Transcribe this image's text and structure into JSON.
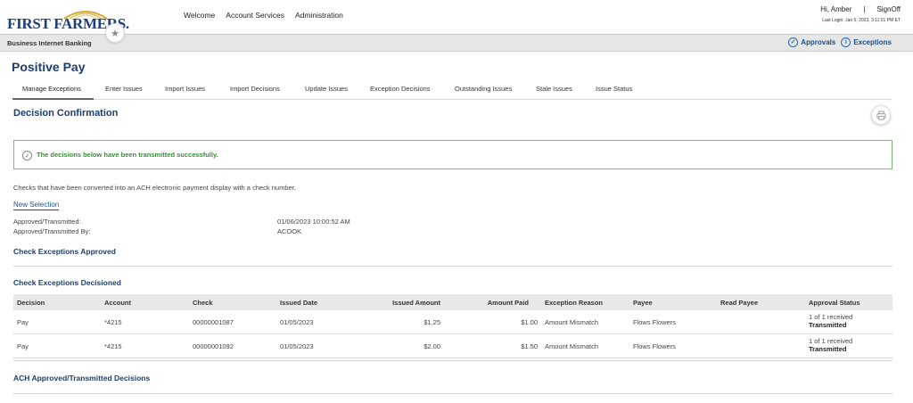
{
  "header": {
    "logo_text": "FIRST FARMERS.",
    "nav": [
      "Welcome",
      "Account Services",
      "Administration"
    ],
    "greeting": "Hi, Amber",
    "separator": "|",
    "signoff": "SignOff",
    "last_login": "Last Login: Jan 5, 2023, 3:11:01 PM ET"
  },
  "subbar": {
    "title": "Business Internet Banking",
    "approvals": "Approvals",
    "exceptions": "Exceptions"
  },
  "page": {
    "title": "Positive Pay",
    "tabs": [
      "Manage Exceptions",
      "Enter Issues",
      "Import Issues",
      "Import Decisions",
      "Update Issues",
      "Exception Decisions",
      "Outstanding Issues",
      "Stale Issues",
      "Issue Status"
    ],
    "section_title": "Decision Confirmation",
    "success_message": "The decisions below have been transmitted successfully.",
    "info_text": "Checks that have been converted into an ACH electronic payment display with a check number.",
    "new_selection": "New Selection",
    "approved_label": "Approved/Transmitted:",
    "approved_value": "01/06/2023 10:00:52 AM",
    "approved_by_label": "Approved/Transmitted By:",
    "approved_by_value": "ACOOK",
    "check_exceptions_approved": "Check Exceptions Approved",
    "check_exceptions_decisioned": "Check Exceptions Decisioned",
    "ach_decisions": "ACH Approved/Transmitted Decisions"
  },
  "table": {
    "columns": [
      "Decision",
      "Account",
      "Check",
      "Issued Date",
      "Issued Amount",
      "Amount Paid",
      "Exception Reason",
      "Payee",
      "Read Payee",
      "Approval Status"
    ],
    "rows": [
      {
        "decision": "Pay",
        "account": "*4215",
        "check": "00000001087",
        "issued_date": "01/05/2023",
        "issued_amount": "$1.25",
        "amount_paid": "$1.00",
        "reason": "Amount Mismatch",
        "payee": "Flows Flowers",
        "read_payee": "",
        "status_line1": "1 of 1 received",
        "status_line2": "Transmitted"
      },
      {
        "decision": "Pay",
        "account": "*4215",
        "check": "00000001092",
        "issued_date": "01/05/2023",
        "issued_amount": "$2.00",
        "amount_paid": "$1.50",
        "reason": "Amount Mismatch",
        "payee": "Flows Flowers",
        "read_payee": "",
        "status_line1": "1 of 1 received",
        "status_line2": "Transmitted"
      }
    ]
  },
  "colors": {
    "brand_navy": "#1c3f7a",
    "heading": "#1c3f6e",
    "link": "#1c4f8a",
    "success_border": "#72bf74",
    "success_text": "#3a8a3a"
  },
  "icons": [
    "star-icon",
    "approvals-check-icon",
    "exceptions-info-icon",
    "print-icon",
    "success-check-icon"
  ]
}
